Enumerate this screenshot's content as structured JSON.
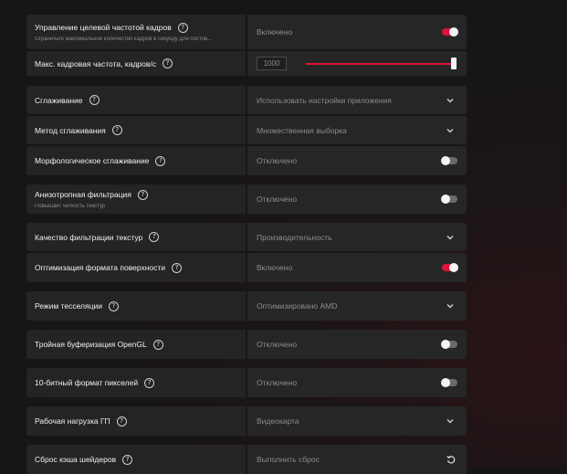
{
  "settings": [
    {
      "label": "Управление целевой частотой кадров",
      "sub": "Ограничьте максимальное количество кадров в секунду для постов...",
      "value": "Включено",
      "control": "toggle-on"
    },
    {
      "label": "Макс. кадровая частота, кадров/с",
      "value": "1000",
      "control": "slider",
      "slider_fraction": 1.0
    },
    {
      "label": "Сглаживание",
      "value": "Использовать настройки приложения",
      "control": "dropdown"
    },
    {
      "label": "Метод сглаживания",
      "value": "Множественная выборка",
      "control": "dropdown"
    },
    {
      "label": "Морфологическое сглаживание",
      "value": "Отключено",
      "control": "toggle-off"
    },
    {
      "label": "Анизотропная фильтрация",
      "sub": "Повышает четкость текстур",
      "value": "Отключено",
      "control": "toggle-off"
    },
    {
      "label": "Качество фильтрации текстур",
      "value": "Производительность",
      "control": "dropdown"
    },
    {
      "label": "Оптимизация формата поверхности",
      "value": "Включено",
      "control": "toggle-on"
    },
    {
      "label": "Режим тесселяции",
      "value": "Оптимизировано AMD",
      "control": "dropdown"
    },
    {
      "label": "Тройная буферизация OpenGL",
      "value": "Отключено",
      "control": "toggle-off"
    },
    {
      "label": "10-битный формат пикселей",
      "value": "Отключено",
      "control": "toggle-off"
    },
    {
      "label": "Рабочая нагрузка ГП",
      "value": "Видеокарта",
      "control": "dropdown"
    },
    {
      "label": "Сброс кэша шейдеров",
      "value": "Выполнить сброс",
      "control": "reset"
    }
  ],
  "colors": {
    "accent": "#e0113d",
    "row_left": "#242424",
    "row_right": "#262626"
  }
}
